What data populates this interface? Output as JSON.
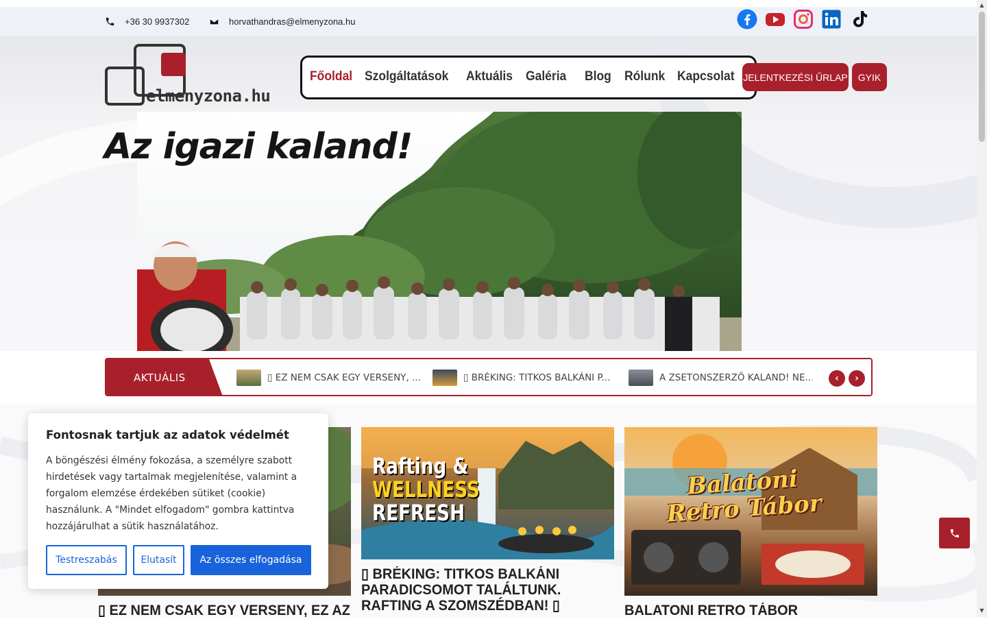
{
  "contact": {
    "phone": "+36 30 9937302",
    "email": "horvathandras@elmenyzona.hu"
  },
  "socials": [
    "facebook-icon",
    "youtube-icon",
    "instagram-icon",
    "linkedin-icon",
    "tiktok-icon"
  ],
  "logo": {
    "text": "elmenyzona.hu"
  },
  "nav": {
    "items": [
      {
        "label": "Főoldal",
        "active": true
      },
      {
        "label": "Szolgáltatások",
        "active": false
      },
      {
        "label": "Aktuális",
        "active": false
      },
      {
        "label": "Galéria",
        "active": false
      },
      {
        "label": "Blog",
        "active": false
      },
      {
        "label": "Rólunk",
        "active": false
      },
      {
        "label": "Kapcsolat",
        "active": false
      }
    ],
    "signup_button": "JELENTKEZÉSI ŰRLAP",
    "faq_button": "GYIK"
  },
  "hero": {
    "title": "Az igazi kaland!"
  },
  "ticker": {
    "label": "AKTUÁLIS",
    "items": [
      "▯ EZ NEM CSAK EGY VERSENY, ...",
      "▯ BRÉKING: TITKOS BALKÁNI P...",
      "A ZSETONSZERZŐ KALAND! NE..."
    ],
    "prev": "‹",
    "next": "›"
  },
  "cards": [
    {
      "title": "▯ EZ NEM CSAK EGY VERSENY, EZ AZ",
      "image": "event-photo"
    },
    {
      "title": "▯ BRÉKING: TITKOS BALKÁNI PARADICSOMOT TALÁLTUNK. RAFTING A SZOMSZÉDBAN! ▯",
      "image": "rafting-poster",
      "image_text_1": "Rafting &",
      "image_text_2": "WELLNESS",
      "image_text_3": "REFRESH"
    },
    {
      "title": "BALATONI RETRO TÁBOR",
      "image": "retro-camp-poster",
      "image_text_1": "Balatoni",
      "image_text_2": "Retro Tábor"
    }
  ],
  "cookie": {
    "title": "Fontosnak tartjuk az adatok védelmét",
    "text": "A böngészési élmény fokozása, a személyre szabott hirdetések vagy tartalmak megjelenítése, valamint a forgalom elemzése érdekében sütiket (cookie) használunk. A \"Mindet elfogadom\" gombra kattintva hozzájárulhat a sütik használatához.",
    "customize": "Testreszabás",
    "reject": "Elutasít",
    "accept_all": "Az összes elfogadása"
  },
  "colors": {
    "brand_red": "#a8202b",
    "cookie_blue": "#1863dc"
  }
}
